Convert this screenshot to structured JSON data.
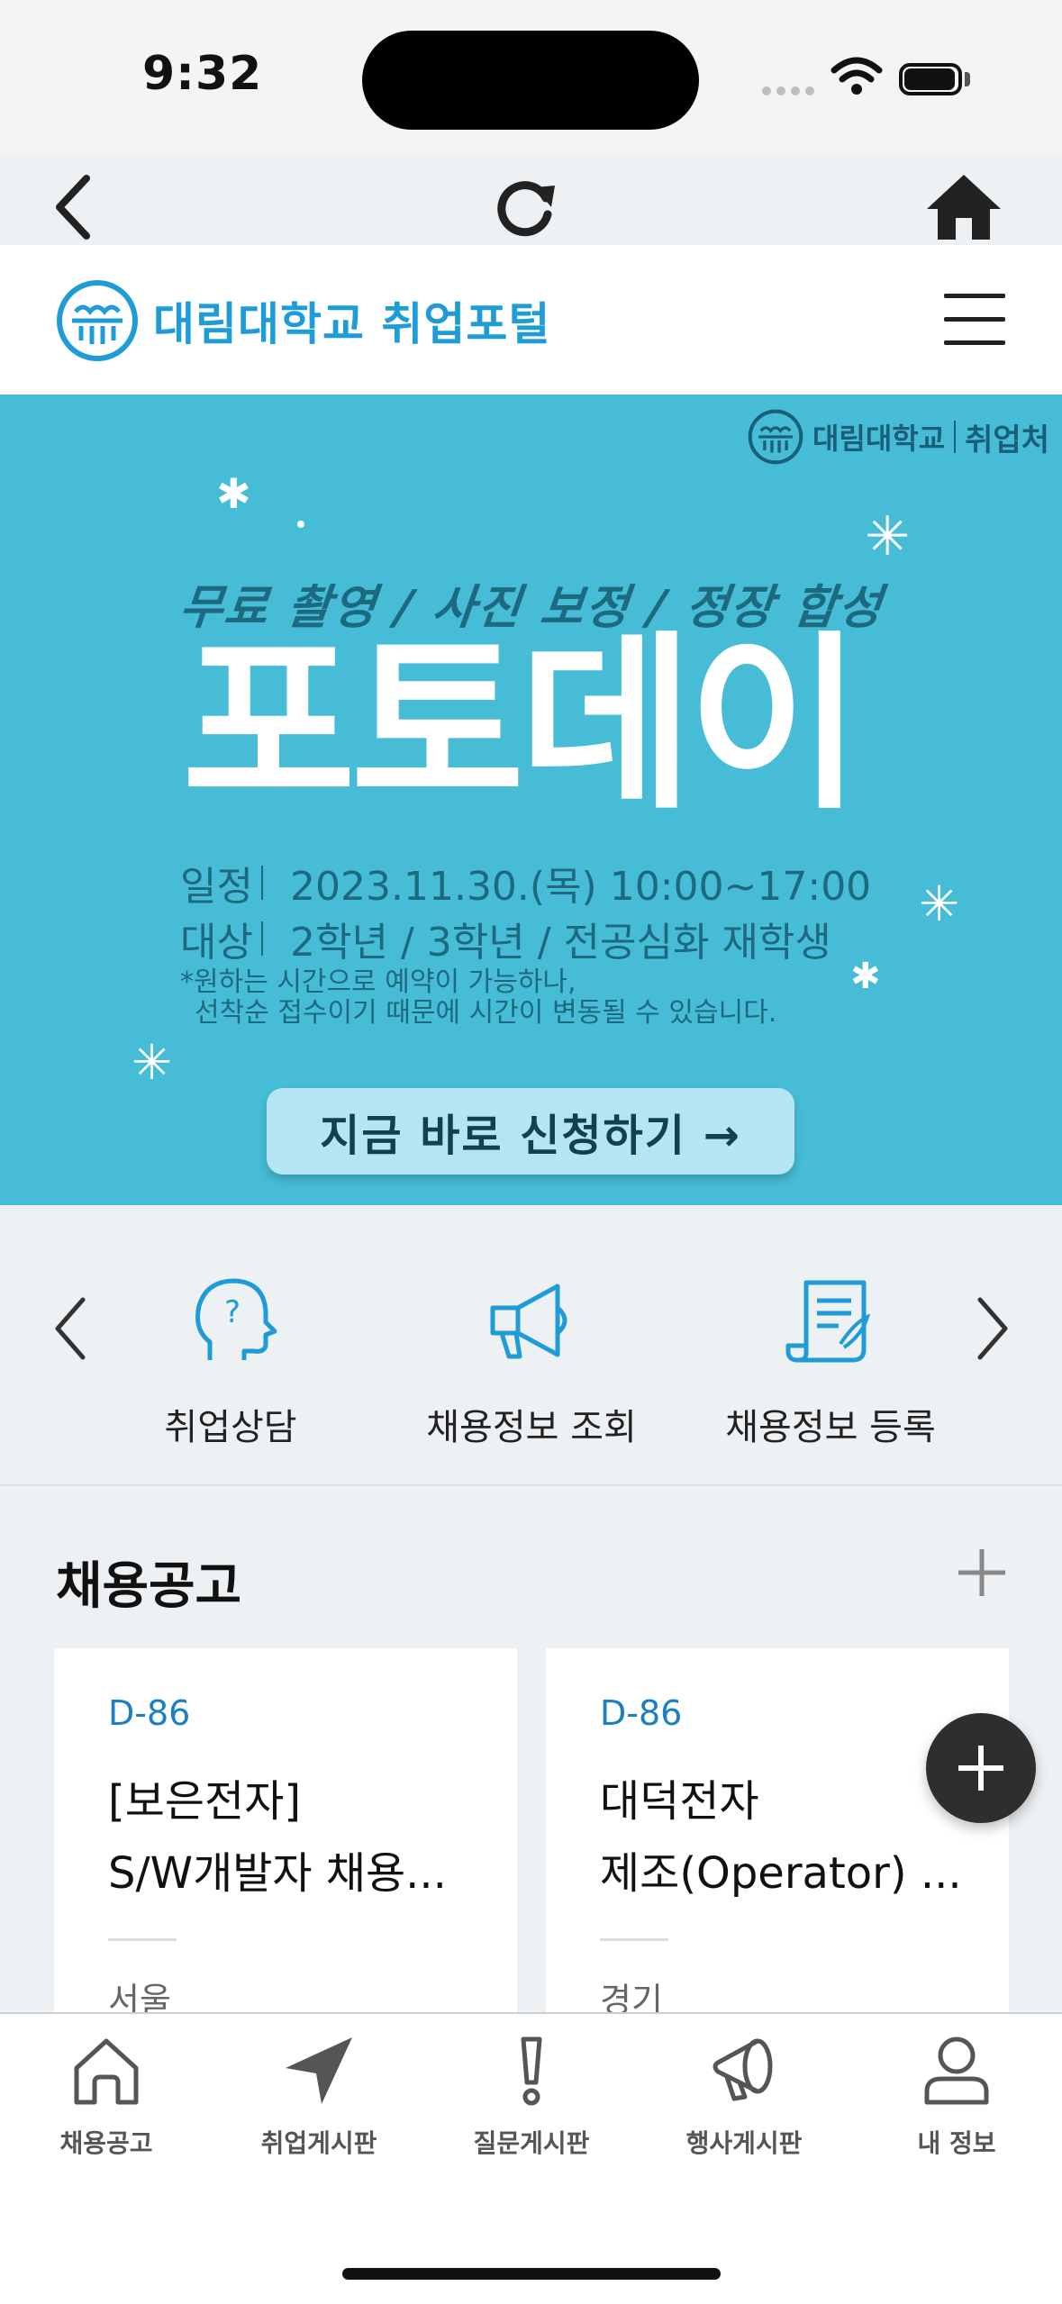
{
  "status_bar": {
    "time": "9:32"
  },
  "browser_toolbar": {
    "back_icon": "chevron-left-icon",
    "reload_icon": "reload-icon",
    "home_icon": "home-icon"
  },
  "header": {
    "brand": "대림대학교 취업포털",
    "menu_icon": "hamburger-icon"
  },
  "banner": {
    "corner_logo_name": "대림대학교",
    "corner_logo_sub": "취업처",
    "subtitle": "무료 촬영 / 사진 보정 / 정장 합성",
    "title": "포토데이",
    "schedule_label": "일정",
    "schedule_value": "2023.11.30.(목) 10:00~17:00",
    "target_label": "대상",
    "target_value": "2학년 / 3학년 / 전공심화 재학생",
    "note_line1": "*원하는 시간으로 예약이 가능하나,",
    "note_line2": "선착순 접수이기 때문에 시간이 변동될 수 있습니다.",
    "cta": "지금 바로 신청하기 →",
    "bg_color": "#47bcd6"
  },
  "quick_menu": {
    "items": [
      {
        "label": "취업상담",
        "icon": "head-question-icon"
      },
      {
        "label": "채용정보 조회",
        "icon": "megaphone-icon"
      },
      {
        "label": "채용정보 등록",
        "icon": "document-pen-icon"
      }
    ]
  },
  "jobs_section": {
    "title": "채용공고",
    "cards": [
      {
        "dday": "D-86",
        "line1": "[보은전자]",
        "line2": "S/W개발자 채용...",
        "location": "서울"
      },
      {
        "dday": "D-86",
        "line1": "대덕전자",
        "line2": "제조(Operator) ...",
        "location": "경기"
      }
    ]
  },
  "tab_bar": {
    "tabs": [
      {
        "label": "채용공고",
        "icon": "house-icon"
      },
      {
        "label": "취업게시판",
        "icon": "paper-plane-icon"
      },
      {
        "label": "질문게시판",
        "icon": "exclamation-icon"
      },
      {
        "label": "행사게시판",
        "icon": "megaphone-icon"
      },
      {
        "label": "내 정보",
        "icon": "person-icon"
      }
    ]
  }
}
